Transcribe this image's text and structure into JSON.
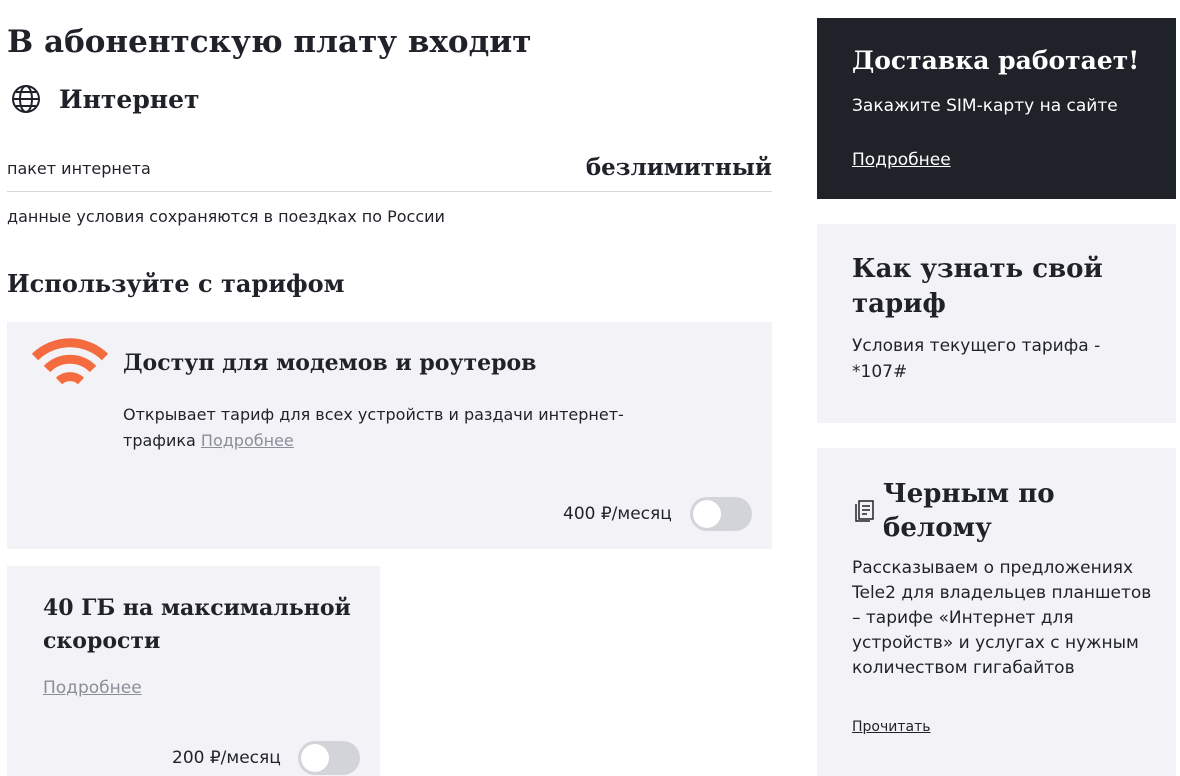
{
  "included": {
    "title": "В абонентскую плату входит",
    "internet": {
      "icon": "globe-icon",
      "title": "Интернет",
      "package_label": "пакет интернета",
      "package_value": "безлимитный",
      "note": "данные условия сохраняются в поездках по России"
    }
  },
  "addons": {
    "title": "Используйте с тарифом",
    "items": [
      {
        "icon": "wifi-icon",
        "title": "Доступ для модемов и роутеров",
        "description": "Открывает тариф для всех устройств и раздачи интернет-трафика",
        "link": "Подробнее",
        "price": "400 ₽/месяц",
        "enabled": false
      },
      {
        "title": "40 ГБ на максимальной скорости",
        "link": "Подробнее",
        "price": "200 ₽/месяц",
        "enabled": false
      }
    ]
  },
  "sidebar": {
    "promo": {
      "title": "Доставка работает!",
      "subtitle": "Закажите SIM-карту на сайте",
      "link": "Подробнее"
    },
    "tariff_info": {
      "title": "Как узнать свой тариф",
      "text": "Условия текущего тарифа - *107#"
    },
    "blog": {
      "icon": "document-icon",
      "title": "Черным по белому",
      "text": "Рассказываем о предложениях Tele2 для владельцев планшетов – тарифе «Интернет для устройств» и услугах с нужным количеством гигабайтов",
      "link": "Прочитать"
    }
  },
  "colors": {
    "accent": "#f36b3e",
    "dark": "#1f2229",
    "card_bg": "#f3f3f7",
    "toggle_off": "#d2d4d9"
  }
}
